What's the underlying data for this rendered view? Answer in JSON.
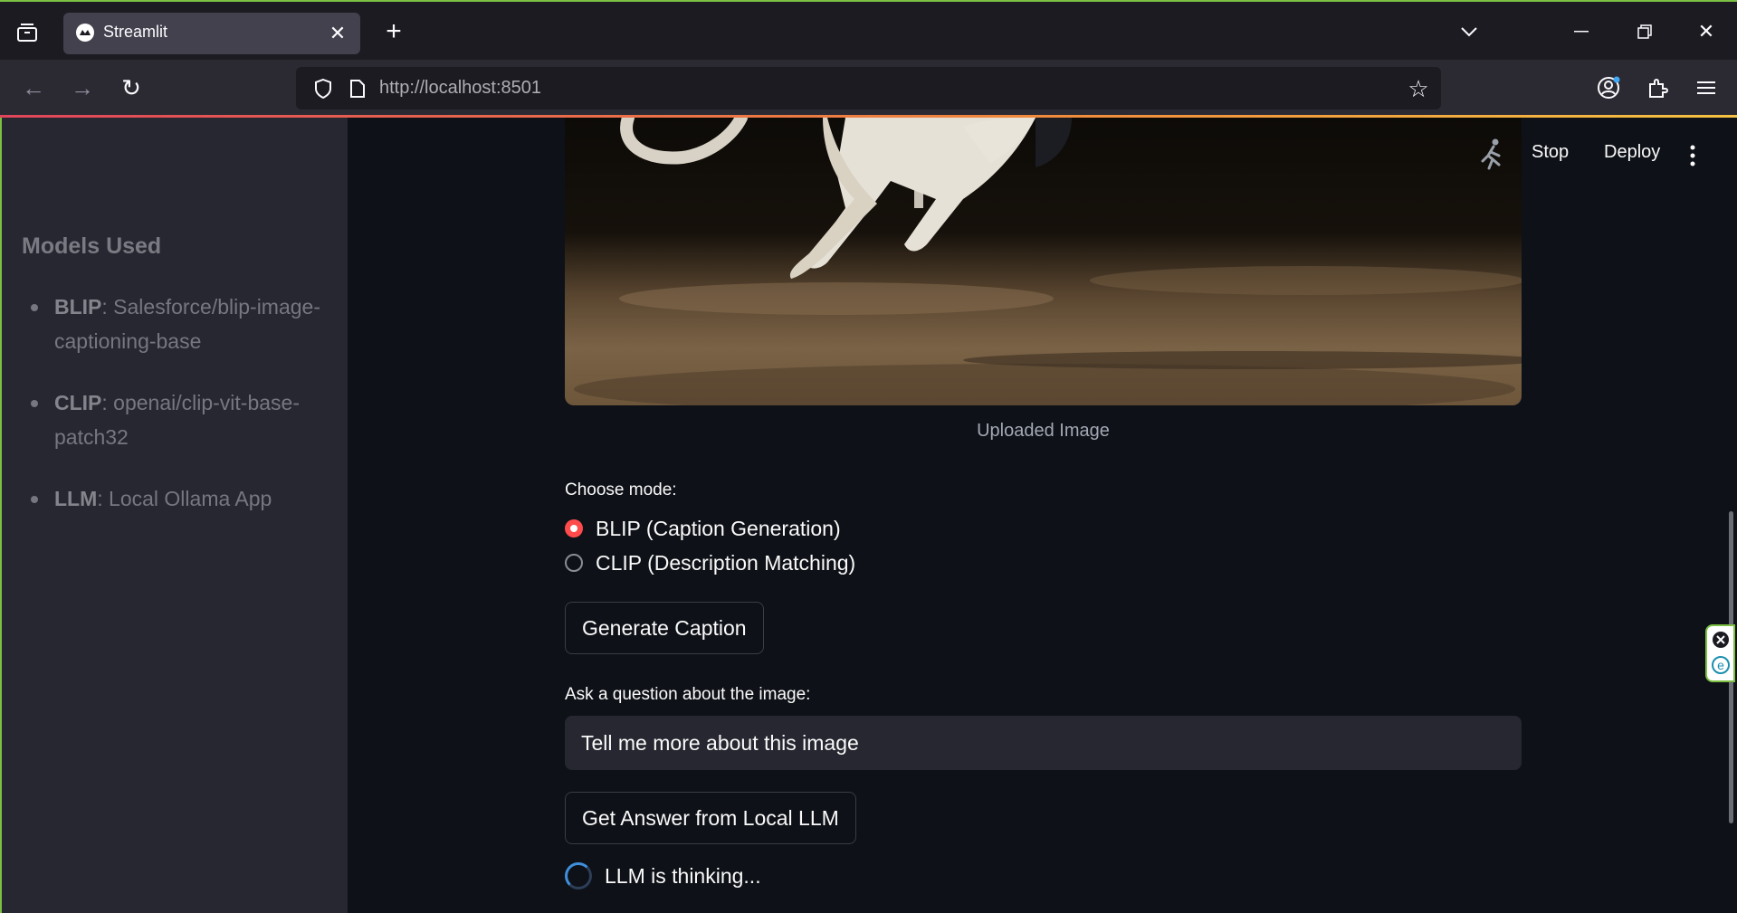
{
  "browser": {
    "tab_title": "Streamlit",
    "url_host": "http://localhost",
    "url_port": ":8501"
  },
  "app_toolbar": {
    "stop_label": "Stop",
    "deploy_label": "Deploy"
  },
  "sidebar": {
    "title": "Models Used",
    "items": [
      {
        "model": "BLIP",
        "detail": ": Salesforce/blip-image-captioning-base"
      },
      {
        "model": "CLIP",
        "detail": ": openai/clip-vit-base-patch32"
      },
      {
        "model": "LLM",
        "detail": ": Local Ollama App"
      }
    ]
  },
  "main": {
    "image_caption": "Uploaded Image",
    "mode_label": "Choose mode:",
    "modes": [
      {
        "label": "BLIP (Caption Generation)",
        "selected": true
      },
      {
        "label": "CLIP (Description Matching)",
        "selected": false
      }
    ],
    "generate_button": "Generate Caption",
    "question_label": "Ask a question about the image:",
    "question_value": "Tell me more about this image",
    "ask_button": "Get Answer from Local LLM",
    "status_text": "LLM is thinking..."
  },
  "colors": {
    "accent": "#ff4b4b",
    "background": "#0e1117",
    "sidebar": "#262730"
  }
}
